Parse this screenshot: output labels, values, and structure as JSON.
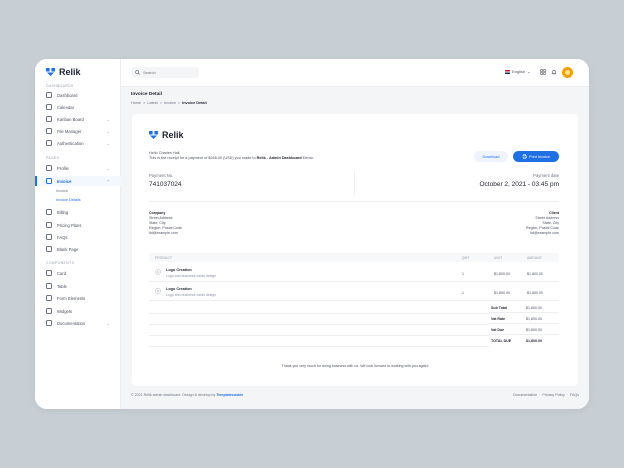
{
  "brand": {
    "name": "Relik",
    "color": "#1f6fe5"
  },
  "sidebar": {
    "sections": [
      {
        "label": "DASHBOARDS"
      },
      {
        "label": "PAGES"
      },
      {
        "label": "COMPONENTS"
      }
    ],
    "items": [
      {
        "label": "Dashboard",
        "icon": "home-icon"
      },
      {
        "label": "Calendar",
        "icon": "calendar-icon"
      },
      {
        "label": "Kanban Board",
        "icon": "kanban-icon",
        "chevron": "⌄"
      },
      {
        "label": "File Manager",
        "icon": "folder-icon",
        "chevron": "⌄"
      },
      {
        "label": "Authentication",
        "icon": "lock-icon",
        "chevron": "⌄"
      },
      {
        "label": "Profile",
        "icon": "user-icon",
        "chevron": "⌄"
      },
      {
        "label": "Invoice",
        "icon": "invoice-icon",
        "chevron": "⌃"
      },
      {
        "label": "Billing",
        "icon": "card-icon"
      },
      {
        "label": "Pricing Plans",
        "icon": "diamond-icon"
      },
      {
        "label": "FAQs",
        "icon": "help-icon"
      },
      {
        "label": "Blank Page",
        "icon": "page-icon"
      },
      {
        "label": "Card",
        "icon": "card-icon"
      },
      {
        "label": "Table",
        "icon": "table-icon"
      },
      {
        "label": "Form Elements",
        "icon": "form-icon"
      },
      {
        "label": "Widgets",
        "icon": "widget-icon"
      },
      {
        "label": "Documentation",
        "icon": "book-icon",
        "chevron": "⌄"
      }
    ],
    "invoice_sub": [
      "Invoice",
      "Invoice Details"
    ]
  },
  "topbar": {
    "search_placeholder": "Search",
    "language": "English",
    "language_chevron": "⌄"
  },
  "page": {
    "title": "Invoice Detail",
    "breadcrumb": [
      "Home",
      ">",
      "Latest",
      ">",
      "Invoice",
      ">",
      "Invoice Detail"
    ]
  },
  "invoice": {
    "greeting": "Hello Charles Hall,",
    "message_pre": "This is the receipt for a payment of $268.00 (USD) you made to ",
    "message_bold": "Relik - Admin Dashboard",
    "message_post": " Demo.",
    "download_label": "Download",
    "print_label": "Print Invoice",
    "payment_no_label": "Payment No.",
    "payment_no": "741037024",
    "payment_date_label": "Payment date",
    "payment_date": "October 2, 2021 - 03:45 pm",
    "company": {
      "heading": "Company",
      "lines": [
        "Street Address",
        "State, City",
        "Region, Postal Code",
        "ltd@example.com"
      ]
    },
    "client": {
      "heading": "Client",
      "lines": [
        "Street Address",
        "State, City",
        "Region, Postal Code",
        "ltd@example.com"
      ]
    },
    "table": {
      "headers": [
        "PRODUCT",
        "QNT",
        "UNIT",
        "AMOUNT"
      ],
      "rows": [
        {
          "num": "1",
          "name": "Logo Creation",
          "desc": "Logo and business cards design",
          "qty": "1",
          "unit": "$1,800.00",
          "amount": "$1,800.00"
        },
        {
          "num": "2",
          "name": "Logo Creation",
          "desc": "Logo and business cards design",
          "qty": "1",
          "unit": "$1,800.00",
          "amount": "$1,800.00"
        }
      ],
      "summary": [
        {
          "label": "Sub Total",
          "value": "$1,800.00"
        },
        {
          "label": "Vat Rate",
          "value": "$1,800.00"
        },
        {
          "label": "Vat Due",
          "value": "$1,800.00"
        },
        {
          "label": "TOTAL DUE",
          "value": "$1,800.00"
        }
      ]
    },
    "thanks": "Thank you very much for doing business with us. We look forward to working with you again!"
  },
  "footer": {
    "copyright": "© 2021 Relik admin dashboard. Design & develop by ",
    "author": "Templatecookie",
    "links": [
      "Documentation",
      "·",
      "Privacy Policy",
      "·",
      "FAQs"
    ]
  }
}
